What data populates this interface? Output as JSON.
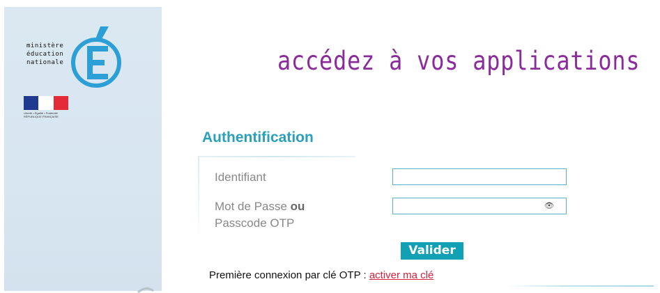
{
  "branding": {
    "logo_lines": [
      "ministère",
      "éducation",
      "nationale"
    ],
    "flag_caption_lines": [
      "Liberté • Égalité • Fraternité",
      "RÉPUBLIQUE FRANÇAISE"
    ],
    "logo_color": "#2b9fd6",
    "flag_colors": [
      "#1f3a8f",
      "#ffffff",
      "#e52b38"
    ]
  },
  "headline": "accédez à vos applications",
  "auth": {
    "title": "Authentification",
    "id_label": "Identifiant",
    "id_value": "",
    "pw_label_part1": "Mot de Passe ",
    "pw_label_bold": "ou",
    "pw_label_part2": "Passcode OTP",
    "pw_value": "",
    "eye_icon": "eye-icon",
    "submit_label": "Valider"
  },
  "otp": {
    "text": "Première connexion par clé OTP : ",
    "link_label": "activer ma clé"
  },
  "colors": {
    "accent": "#2aa1b9",
    "headline": "#8b2a9a",
    "button": "#12a1b4",
    "link": "#d4213d"
  }
}
